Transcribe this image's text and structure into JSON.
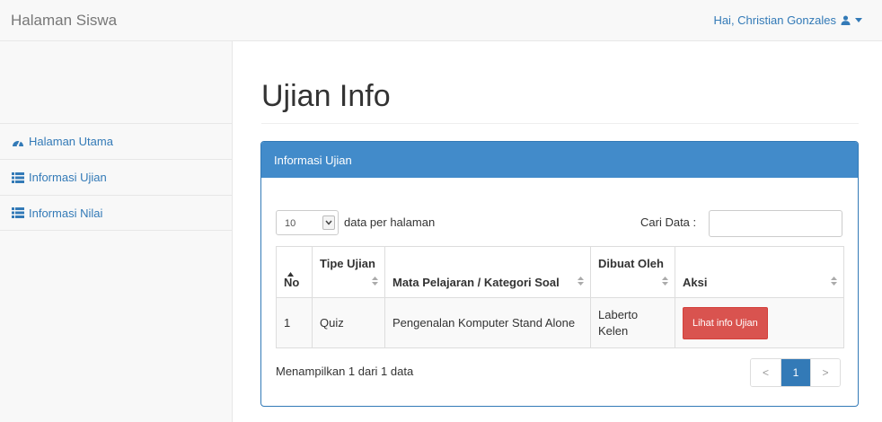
{
  "navbar": {
    "brand": "Halaman Siswa",
    "user_greeting": "Hai, Christian Gonzales",
    "user_icon": "user-icon",
    "caret_icon": "caret-down-icon"
  },
  "sidebar": {
    "items": [
      {
        "label": "Halaman Utama",
        "icon": "dashboard-icon"
      },
      {
        "label": "Informasi Ujian",
        "icon": "list-icon"
      },
      {
        "label": "Informasi Nilai",
        "icon": "list-icon"
      }
    ]
  },
  "page": {
    "title": "Ujian Info"
  },
  "panel": {
    "heading": "Informasi Ujian"
  },
  "table_controls": {
    "page_length": "10",
    "length_label": "data per halaman",
    "search_label": "Cari Data :",
    "search_value": ""
  },
  "table": {
    "columns": [
      "No",
      "Tipe Ujian",
      "Mata Pelajaran / Kategori Soal",
      "Dibuat Oleh",
      "Aksi"
    ],
    "rows": [
      {
        "no": "1",
        "tipe": "Quiz",
        "mapel": "Pengenalan Komputer Stand Alone",
        "dibuat_oleh": "Laberto Kelen",
        "aksi": "Lihat info Ujian"
      }
    ]
  },
  "footer": {
    "info": "Menampilkan 1 dari 1 data",
    "pagination": {
      "prev": "<",
      "current": "1",
      "next": ">"
    }
  },
  "colors": {
    "accent": "#337ab7",
    "panel_heading": "#428bca",
    "danger": "#d9534f",
    "navbar_bg": "#f8f8f8"
  }
}
